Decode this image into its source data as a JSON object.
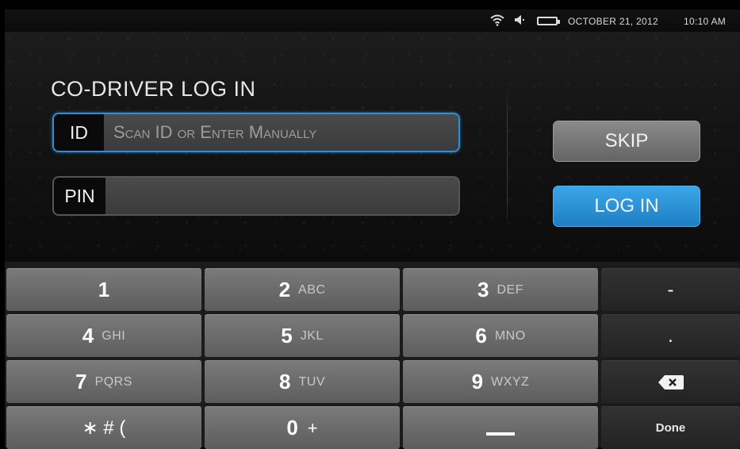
{
  "status_bar": {
    "date": "OCTOBER 21, 2012",
    "time": "10:10 AM",
    "icons": [
      "wifi-icon",
      "speaker-icon",
      "battery-icon"
    ]
  },
  "login": {
    "title": "CO-DRIVER LOG IN",
    "id_label": "ID",
    "id_placeholder": "Scan ID or Enter Manually",
    "id_value": "",
    "pin_label": "PIN",
    "pin_value": "",
    "skip_label": "SKIP",
    "login_label": "LOG IN"
  },
  "keypad": {
    "k1": {
      "num": "1",
      "sub": ""
    },
    "k2": {
      "num": "2",
      "sub": "ABC"
    },
    "k3": {
      "num": "3",
      "sub": "DEF"
    },
    "k4": {
      "num": "4",
      "sub": "GHI"
    },
    "k5": {
      "num": "5",
      "sub": "JKL"
    },
    "k6": {
      "num": "6",
      "sub": "MNO"
    },
    "k7": {
      "num": "7",
      "sub": "PQRS"
    },
    "k8": {
      "num": "8",
      "sub": "TUV"
    },
    "k9": {
      "num": "9",
      "sub": "WXYZ"
    },
    "k0": {
      "num": "0",
      "sub": "+"
    },
    "symbols": "∗ # (",
    "dash": "-",
    "dot": ".",
    "done": "Done",
    "space_icon": "space-icon",
    "backspace_icon": "backspace-icon"
  },
  "colors": {
    "accent_blue": "#2f8fd6",
    "login_button": "#2a90d6",
    "skip_button": "#777777"
  }
}
